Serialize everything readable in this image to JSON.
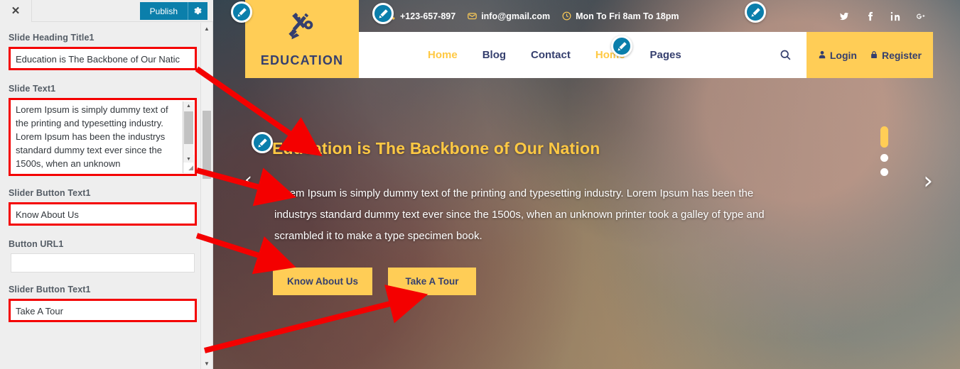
{
  "customizer": {
    "close_label": "✕",
    "publish_label": "Publish",
    "gear_icon": "gear-icon",
    "fields": [
      {
        "label": "Slide Heading Title1",
        "value": "Education is The Backbone of Our Natic",
        "type": "text",
        "highlighted": true
      },
      {
        "label": "Slide Text1",
        "value": "Lorem Ipsum is simply dummy text of the printing and typesetting industry. Lorem Ipsum has been the industrys standard dummy text ever since the 1500s, when an unknown",
        "type": "textarea",
        "highlighted": true
      },
      {
        "label": "Slider Button Text1",
        "value": "Know About Us",
        "type": "text",
        "highlighted": true
      },
      {
        "label": "Button URL1",
        "value": "",
        "type": "text",
        "highlighted": false
      },
      {
        "label": "Slider Button Text1",
        "value": "Take A Tour",
        "type": "text",
        "highlighted": true
      }
    ]
  },
  "site": {
    "logo_text": "EDUCATION",
    "logo_icon": "pencil-ruler-icon",
    "topbar": {
      "phone": "+123-657-897",
      "phone_icon": "phone-icon",
      "email": "info@gmail.com",
      "email_icon": "envelope-icon",
      "hours": "Mon To Fri 8am To 18pm",
      "hours_icon": "clock-icon",
      "socials": [
        {
          "name": "twitter-icon",
          "glyph": "twitter"
        },
        {
          "name": "facebook-icon",
          "glyph": "facebook"
        },
        {
          "name": "linkedin-icon",
          "glyph": "linkedin"
        },
        {
          "name": "googleplus-icon",
          "glyph": "googleplus"
        }
      ]
    },
    "nav": {
      "items": [
        {
          "label": "Home",
          "active": true
        },
        {
          "label": "Blog",
          "active": false
        },
        {
          "label": "Contact",
          "active": false
        },
        {
          "label": "Home",
          "active": true
        },
        {
          "label": "Pages",
          "active": false
        }
      ],
      "search_icon": "search-icon",
      "login_label": "Login",
      "login_icon": "user-icon",
      "register_label": "Register",
      "register_icon": "lock-icon"
    },
    "hero": {
      "title": "Education is The Backbone of Our Nation",
      "text": "Lorem Ipsum is simply dummy text of the printing and typesetting industry. Lorem Ipsum has been the industrys standard dummy text ever since the 1500s, when an unknown printer took a galley of type and scrambled it to make a type specimen book.",
      "button1": "Know About Us",
      "button2": "Take A Tour",
      "prev_arrow": "‹",
      "next_arrow": "›",
      "slides_total": 3,
      "slide_active_index": 0
    },
    "colors": {
      "brand_yellow": "#ffcd56",
      "brand_navy": "#353f6e",
      "edit_badge_blue": "#0a7eab",
      "publish_blue": "#0b7fab",
      "annotation_red": "#f40000"
    }
  }
}
